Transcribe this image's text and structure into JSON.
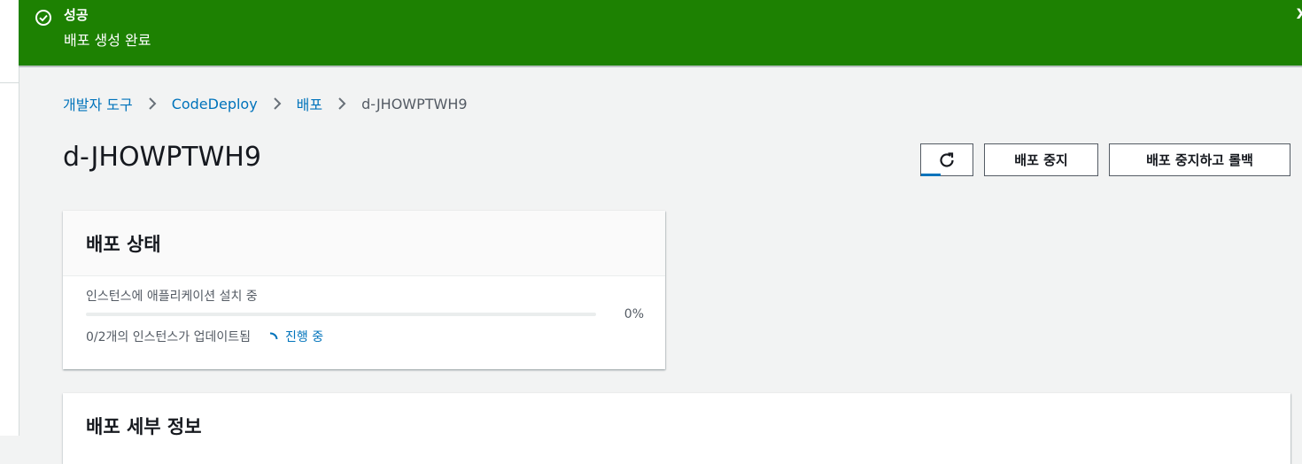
{
  "flash": {
    "title": "성공",
    "message": "배포 생성 완료",
    "close_label": "X",
    "color": "#1d8102"
  },
  "breadcrumb": {
    "items": [
      "개발자 도구",
      "CodeDeploy",
      "배포"
    ],
    "current": "d-JHOWPTWH9"
  },
  "page": {
    "title": "d-JHOWPTWH9"
  },
  "actions": {
    "refresh_icon": "refresh-icon",
    "stop_label": "배포 중지",
    "stop_rollback_label": "배포 중지하고 롤백"
  },
  "status_card": {
    "title": "배포 상태",
    "step_label": "인스턴스에 애플리케이션 설치 중",
    "progress_text": "0%",
    "progress_value": 0,
    "updated_text": "0/2개의 인스턴스가 업데이트됨",
    "status_text": "진행 중"
  },
  "details_card": {
    "title": "배포 세부 정보"
  },
  "colors": {
    "link": "#0073bb",
    "success": "#1d8102",
    "background": "#f2f3f3"
  }
}
